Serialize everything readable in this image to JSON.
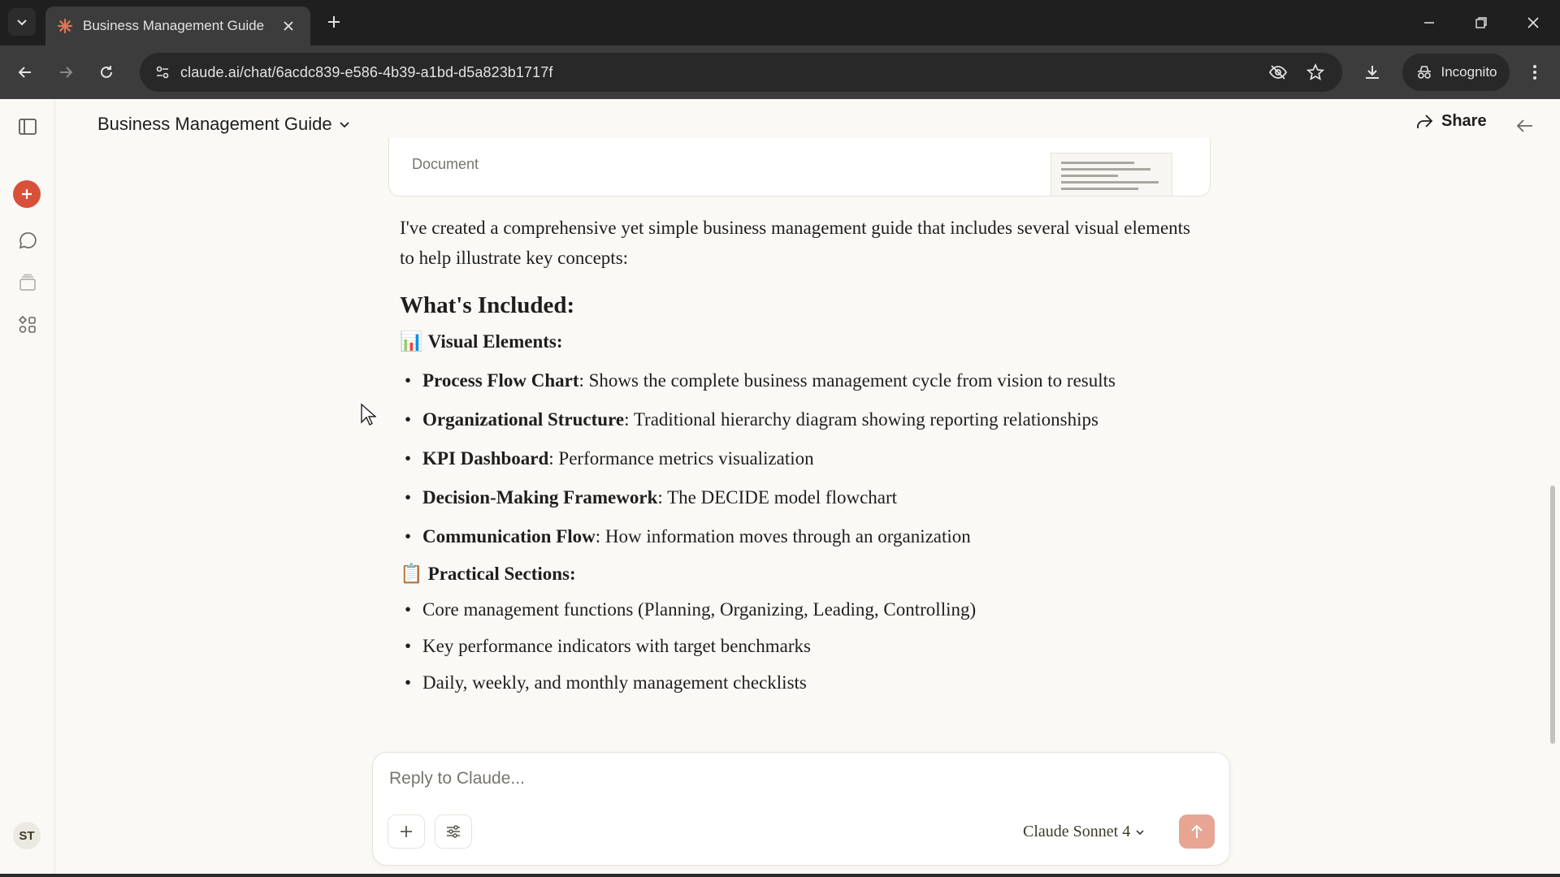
{
  "browser": {
    "tab_title": "Business Management Guide",
    "url": "claude.ai/chat/6acdc839-e586-4b39-a1bd-d5a823b1717f",
    "incognito_label": "Incognito"
  },
  "header": {
    "title": "Business Management Guide",
    "share_label": "Share"
  },
  "sidebar": {
    "avatar_initials": "ST"
  },
  "artifact": {
    "type_label": "Document"
  },
  "message": {
    "intro": "I've created a comprehensive yet simple business management guide that includes several visual elements to help illustrate key concepts:",
    "heading": "What's Included:",
    "section1": {
      "icon": "📊",
      "title": "Visual Elements:",
      "items": [
        {
          "bold": "Process Flow Chart",
          "text": ": Shows the complete business management cycle from vision to results"
        },
        {
          "bold": "Organizational Structure",
          "text": ": Traditional hierarchy diagram showing reporting relationships"
        },
        {
          "bold": "KPI Dashboard",
          "text": ": Performance metrics visualization"
        },
        {
          "bold": "Decision-Making Framework",
          "text": ": The DECIDE model flowchart"
        },
        {
          "bold": "Communication Flow",
          "text": ": How information moves through an organization"
        }
      ]
    },
    "section2": {
      "icon": "📋",
      "title": "Practical Sections:",
      "items": [
        "Core management functions (Planning, Organizing, Leading, Controlling)",
        "Key performance indicators with target benchmarks",
        "Daily, weekly, and monthly management checklists"
      ]
    }
  },
  "composer": {
    "placeholder": "Reply to Claude...",
    "model_label": "Claude Sonnet 4"
  },
  "colors": {
    "accent": "#d9503a",
    "send_disabled": "#e8a594",
    "background": "#faf9f5"
  }
}
